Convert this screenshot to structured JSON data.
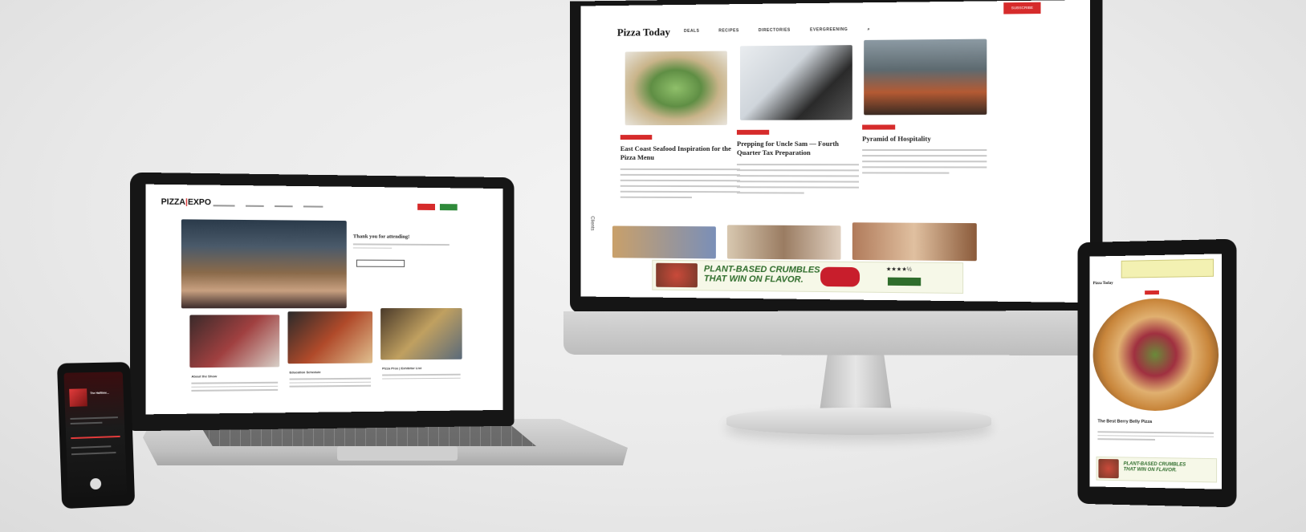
{
  "desktop": {
    "site_logo": "Pizza Today",
    "nav": [
      "DEALS",
      "RECIPES",
      "DIRECTORIES",
      "EVERGREENING",
      "⌕"
    ],
    "subscribe_label": "SUBSCRIBE",
    "articles": [
      {
        "title": "East Coast Seafood Inspiration for the Pizza Menu"
      },
      {
        "title": "Prepping for Uncle Sam — Fourth Quarter Tax Preparation"
      },
      {
        "title": "Pyramid of Hospitality"
      }
    ],
    "side_label": "Clients",
    "ad": {
      "headline_1": "PLANT-BASED CRUMBLES",
      "headline_2": "THAT WIN ON FLAVOR.",
      "stars": "★★★★½"
    }
  },
  "laptop": {
    "site_logo_1": "PIZZA",
    "site_logo_sep": "|",
    "site_logo_2": "EXPO",
    "heading": "Thank you for attending!",
    "captions": [
      "About the Show",
      "Education Schedule",
      "Pizza Pros | Exhibitor List"
    ]
  },
  "tablet": {
    "site_logo": "Pizza Today",
    "article_title": "The Best Berry Belly Pizza",
    "ad": {
      "headline_1": "PLANT-BASED CRUMBLES",
      "headline_2": "THAT WIN ON FLAVOR."
    }
  },
  "phone": {
    "episode_title": "The Halftime..."
  },
  "colors": {
    "accent_red": "#d62b2b",
    "ad_green": "#2f6d2c"
  }
}
